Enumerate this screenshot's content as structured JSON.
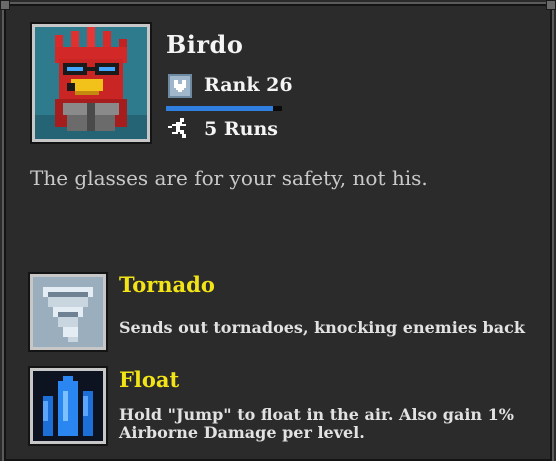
{
  "character": {
    "name": "Birdo",
    "rank_label": "Rank 26",
    "runs_label": "5 Runs",
    "xp_progress": 0.92,
    "description": "The glasses are for your safety, not his."
  },
  "abilities": [
    {
      "name": "Tornado",
      "description": "Sends out tornadoes, knocking enemies back",
      "icon": "tornado-icon"
    },
    {
      "name": "Float",
      "description": "Hold \"Jump\" to float in the air. Also gain 1% Airborne Damage per level.",
      "icon": "float-icon"
    }
  ],
  "colors": {
    "panel": "#2b2b2b",
    "ability_title": "#f3e418",
    "xp_bar": "#2f7ee0"
  }
}
